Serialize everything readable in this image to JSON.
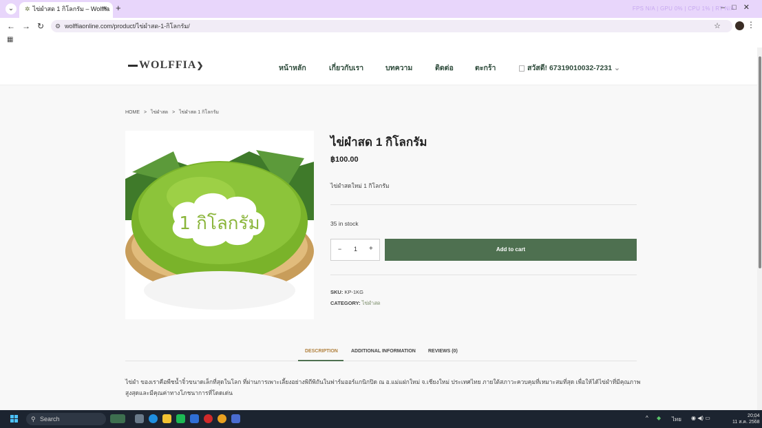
{
  "browser": {
    "tab_title": "ไข่ผำสด 1 กิโลกรัม – Wolffia",
    "tab_close": "×",
    "new_tab": "+",
    "perf_overlay": "FPS N/A | GPU 0% | CPU 1% | RT N/A",
    "url": "wolffiaonline.com/product/ไข่ผำสด-1-กิโลกรัม/"
  },
  "site": {
    "logo": "WOLFFIA",
    "nav": [
      "หน้าหลัก",
      "เกี่ยวกับเรา",
      "บทความ",
      "ติดต่อ",
      "ตะกร้า"
    ],
    "greeting": "สวัสดี! 67319010032-7231",
    "greeting_caret": "⌄"
  },
  "breadcrumb": [
    "HOME",
    ">",
    "ไข่ผำสด",
    ">",
    "ไข่ผำสด 1 กิโลกรัม"
  ],
  "product": {
    "title": "ไข่ผำสด 1 กิโลกรัม",
    "price": "฿100.00",
    "short_description": "ไข่ผำสดใหม่ 1 กิโลกรัม",
    "image_label": "1 กิโลกรัม",
    "stock": "35 in stock",
    "qty_minus": "−",
    "qty_value": "1",
    "qty_plus": "+",
    "add_to_cart": "Add to cart",
    "sku_label": "SKU:",
    "sku_value": "KP-1KG",
    "category_label": "CATEGORY:",
    "category_value": "ไข่ผำสด"
  },
  "tabs": [
    {
      "label": "DESCRIPTION"
    },
    {
      "label": "ADDITIONAL INFORMATION"
    },
    {
      "label": "REVIEWS (0)"
    }
  ],
  "description": "ไข่ผำ ของเราคือพืชน้ำจิ๋วขนาดเล็กที่สุดในโลก ที่ผ่านการเพาะเลี้ยงอย่างพิถีพิถันในฟาร์มออร์แกนิกปิด ณ อ.แม่แฝกใหม่ จ.เชียงใหม่ ประเทศไทย ภายใต้สภาวะควบคุมที่เหมาะสมที่สุด เพื่อให้ได้ไข่ผำที่มีคุณภาพสูงสุดและมีคุณค่าทางโภชนาการที่โดดเด่น",
  "taskbar": {
    "search_placeholder": "Search",
    "tray_lang": "ไทย",
    "time": "20:04",
    "date": "11 ส.ค. 2568"
  },
  "colors": {
    "accent_green": "#4e7050",
    "tab_active": "#b0803d",
    "browser_chrome": "#e8d6fb"
  }
}
